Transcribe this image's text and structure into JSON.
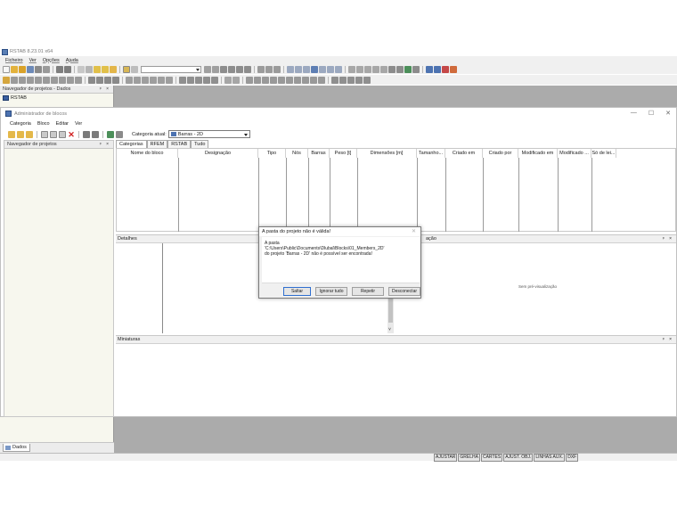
{
  "app": {
    "title": "RSTAB 8.23.01 x64"
  },
  "menu": [
    "Ficheiro",
    "Ver",
    "Opções",
    "Ajuda"
  ],
  "toolbar1": {
    "combo_value": ""
  },
  "navigator": {
    "title": "Navegador de projetos - Dados",
    "panel_controls": "ᵖ ×",
    "root_item": "RSTAB",
    "bottom_tab": "Dados"
  },
  "block_manager": {
    "title": "Administrador de blocos",
    "window_controls": [
      "—",
      "☐",
      "✕"
    ],
    "menu": [
      "Categoria",
      "Bloco",
      "Editar",
      "Ver"
    ],
    "category_label": "Categoria atual:",
    "category_value": "Barras - 2D",
    "navigator_title": "Navegador de projetos",
    "navigator_controls": "ᵖ ×",
    "tabs": [
      "Categorias",
      "RFEM",
      "RSTAB",
      "Tudo"
    ],
    "columns": [
      "Nome do bloco",
      "Designação",
      "Tipo",
      "Nós",
      "Barras",
      "Peso [t]",
      "Dimensões [m]",
      "Tamanho...",
      "Criado em",
      "Criado por",
      "Modificado em",
      "Modificado ...",
      "Só de lei..."
    ],
    "details_title": "Detalhes",
    "details_controls": "ᵖ ×",
    "preview_label": "ação",
    "preview_text": "Sem pré-visualização",
    "thumbnails_title": "Miniaturas",
    "thumbnails_controls": "ᵖ ×",
    "scroll_arrow": "˅"
  },
  "dialog": {
    "title": "A pasta do projeto não é válida!",
    "close": "✕",
    "lines": [
      "A pasta",
      "'C:\\Users\\Public\\Documents\\Dlubal\\Blocks\\01_Members_2D'",
      "do projeto 'Barras - 2D' não é possível ser encontrada!"
    ],
    "buttons": {
      "skip": "Saltar",
      "ignore_all": "Ignorar tudo",
      "retry": "Repetir",
      "disconnect": "Desconectar"
    }
  },
  "status_bar": [
    "AJUSTAR",
    "GRELHA",
    "CARTES",
    "AJUST. OBJ.",
    "LINHAS AUX.",
    "DXF"
  ],
  "colors": {
    "accent": "#2f6fcf",
    "workspace": "#ababab",
    "panel_bg": "#f7f7ee"
  }
}
